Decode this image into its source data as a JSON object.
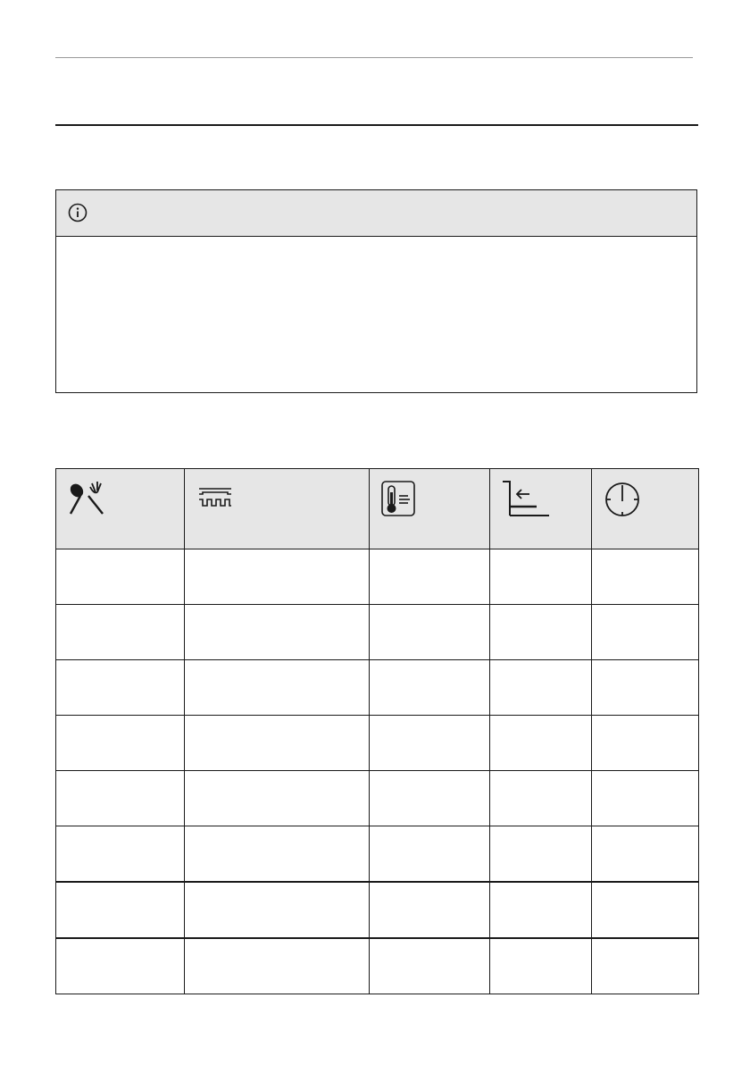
{
  "page": {
    "header_text": "",
    "section_title": ""
  },
  "info_box": {
    "icon": "info-circle-icon",
    "title": "",
    "body": ""
  },
  "table": {
    "headers": [
      {
        "icon": "food-spoon-fork-icon",
        "label": ""
      },
      {
        "icon": "heating-function-icon",
        "label": ""
      },
      {
        "icon": "temperature-thermometer-icon",
        "label": ""
      },
      {
        "icon": "shelf-level-icon",
        "label": ""
      },
      {
        "icon": "time-clock-icon",
        "label": ""
      }
    ],
    "rows": [
      [
        "",
        "",
        "",
        "",
        ""
      ],
      [
        "",
        "",
        "",
        "",
        ""
      ],
      [
        "",
        "",
        "",
        "",
        ""
      ],
      [
        "",
        "",
        "",
        "",
        ""
      ],
      [
        "",
        "",
        "",
        "",
        ""
      ],
      [
        "",
        "",
        "",
        "",
        ""
      ],
      [
        "",
        "",
        "",
        "",
        ""
      ],
      [
        "",
        "",
        "",
        "",
        ""
      ]
    ]
  }
}
